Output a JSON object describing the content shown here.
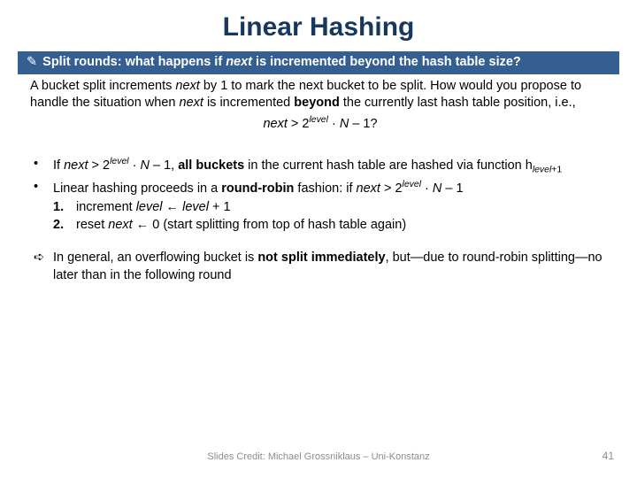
{
  "title": "Linear Hashing",
  "banner": {
    "icon": "✎",
    "prefix": "Split rounds: what happens if ",
    "mid_italic": "next",
    "suffix": " is incremented beyond the hash table size?"
  },
  "intro": {
    "l1a": "A bucket split increments ",
    "l1b": "next",
    "l1c": " by 1 to mark the next bucket to be split. How would you propose to handle the situation when ",
    "l1d": "next",
    "l1e": " is incremented ",
    "l1f": "beyond",
    "l1g": " the currently last hash table position, i.e.,",
    "formula_next": "next",
    "formula_gt": " > 2",
    "formula_sup": "level",
    "formula_dot": " · ",
    "formula_N": "N",
    "formula_tail": " – 1?"
  },
  "b1": {
    "a": "If ",
    "next": "next",
    "b": " > 2",
    "sup": "level",
    "c": " · ",
    "N": "N",
    "d": " – 1, ",
    "e": "all buckets",
    "f": " in the current hash table are hashed via function h",
    "sub": "level",
    "g": "+1"
  },
  "b2": {
    "a": "Linear hashing proceeds in a ",
    "b": "round-robin",
    "c": " fashion: if ",
    "next": "next",
    "d": " > 2",
    "sup": "level",
    "e": " · ",
    "N": "N",
    "f": " – 1"
  },
  "n1": {
    "num": "1.",
    "a": "increment ",
    "b": "level",
    "c": " ← ",
    "d": "level",
    "e": " + 1"
  },
  "n2": {
    "num": "2.",
    "a": "reset ",
    "b": "next",
    "c": " ← 0 (start splitting from top of hash table again)"
  },
  "conclusion": {
    "sym": "➪",
    "a": "In general, an overflowing bucket is ",
    "b": "not split immediately",
    "c": ", but—due to round-robin splitting—no later than in the following round"
  },
  "footer": "Slides Credit: Michael Grossniklaus – Uni-Konstanz",
  "page": "41"
}
